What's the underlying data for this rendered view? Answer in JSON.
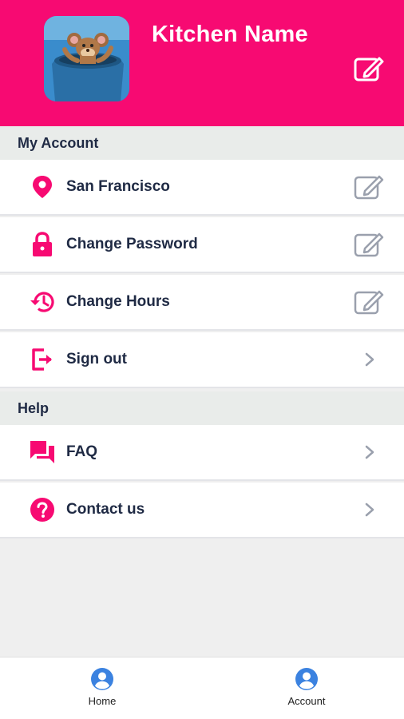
{
  "header": {
    "title": "Kitchen Name",
    "avatar_icon": "cartoon-mouse-avatar",
    "edit_icon": "edit-icon",
    "bg_color": "#f70a72"
  },
  "my_account": {
    "heading": "My Account",
    "items": [
      {
        "label": "San Francisco",
        "icon": "location-pin-icon",
        "action_icon": "edit-icon"
      },
      {
        "label": "Change Password",
        "icon": "lock-icon",
        "action_icon": "edit-icon"
      },
      {
        "label": "Change Hours",
        "icon": "history-icon",
        "action_icon": "edit-icon"
      },
      {
        "label": "Sign out",
        "icon": "sign-out-icon",
        "action_icon": "chevron-right-icon"
      }
    ]
  },
  "help": {
    "heading": "Help",
    "items": [
      {
        "label": "FAQ",
        "icon": "chat-bubbles-icon",
        "action_icon": "chevron-right-icon"
      },
      {
        "label": "Contact us",
        "icon": "question-circle-icon",
        "action_icon": "chevron-right-icon"
      }
    ]
  },
  "bottom_nav": {
    "items": [
      {
        "label": "Home",
        "icon": "account-circle-icon"
      },
      {
        "label": "Account",
        "icon": "account-circle-icon"
      }
    ]
  },
  "colors": {
    "accent": "#f70a72",
    "nav_icon": "#3b82e0",
    "text": "#1f2a44",
    "muted_icon": "#9aa0ad"
  }
}
